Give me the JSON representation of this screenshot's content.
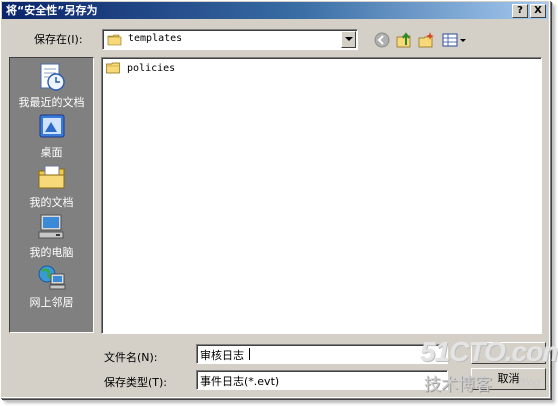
{
  "window": {
    "title": "将“安全性”另存为",
    "help_btn": "?",
    "close_btn": "X"
  },
  "toolbar": {
    "save_in_label": "保存在(I):",
    "folder_value": "templates",
    "back_icon": "back-arrow-icon",
    "up_icon": "up-folder-icon",
    "new_folder_icon": "new-folder-icon",
    "view_icon": "view-menu-icon"
  },
  "places": [
    {
      "label": "我最近的文档",
      "icon": "recent-documents-icon"
    },
    {
      "label": "桌面",
      "icon": "desktop-icon"
    },
    {
      "label": "我的文档",
      "icon": "my-documents-icon"
    },
    {
      "label": "我的电脑",
      "icon": "my-computer-icon"
    },
    {
      "label": "网上邻居",
      "icon": "network-places-icon"
    }
  ],
  "files": [
    {
      "name": "policies",
      "icon": "folder-icon"
    }
  ],
  "filename": {
    "label": "文件名(N):",
    "value": "审核日志"
  },
  "filetype": {
    "label": "保存类型(T):",
    "value": "事件日志(*.evt)"
  },
  "buttons": {
    "save": "",
    "cancel": "取消"
  },
  "watermark": {
    "line1": "51CTO.com",
    "line2": "技术博客",
    "line3": "Blog"
  },
  "colors": {
    "title_start": "#0a246a",
    "title_end": "#a6caf0",
    "face": "#d4d0c8",
    "places_bg": "#808080"
  }
}
